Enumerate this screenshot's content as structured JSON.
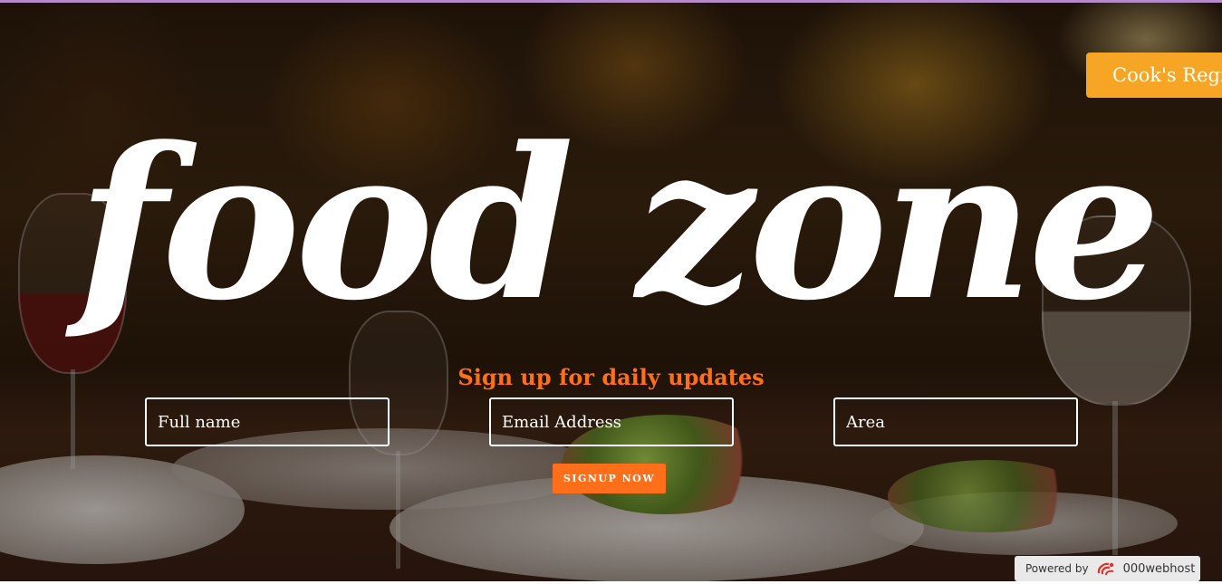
{
  "header": {
    "cook_register_label": "Cook's Regis"
  },
  "hero": {
    "brand": "food zone",
    "tagline": "Sign up for daily updates"
  },
  "form": {
    "name_placeholder": "Full name",
    "email_placeholder": "Email Address",
    "area_placeholder": "Area",
    "submit_label": "SIGNUP NOW"
  },
  "footer": {
    "powered_by": "Powered by",
    "host_name": "000webhost",
    "host_icon": "000webhost-logo-icon"
  },
  "colors": {
    "accent_orange": "#ff6f1a",
    "cook_button": "#f7a524",
    "text_white": "#ffffff"
  }
}
